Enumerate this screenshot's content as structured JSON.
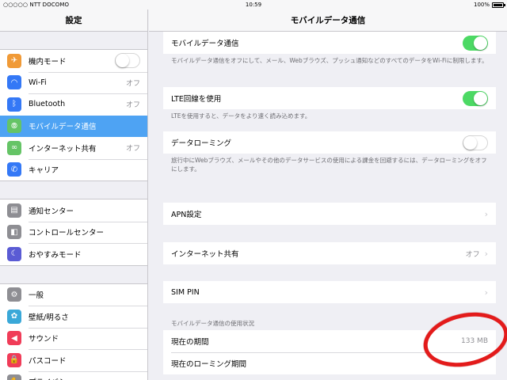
{
  "status_bar": {
    "carrier": "○○○○○ NTT DOCOMO",
    "time": "10:59",
    "battery": "100%"
  },
  "left": {
    "title": "設定",
    "groups": [
      [
        {
          "label": "機内モード",
          "icon": "airplane-icon",
          "color": "#f09a37",
          "glyph": "✈"
        },
        {
          "label": "Wi-Fi",
          "icon": "wifi-icon",
          "color": "#3478f6",
          "glyph": "◠",
          "value": "オフ"
        },
        {
          "label": "Bluetooth",
          "icon": "bluetooth-icon",
          "color": "#3478f6",
          "glyph": "ᛒ",
          "value": "オフ"
        },
        {
          "label": "モバイルデータ通信",
          "icon": "antenna-icon",
          "color": "#65c466",
          "glyph": "⦾",
          "selected": true
        },
        {
          "label": "インターネット共有",
          "icon": "hotspot-icon",
          "color": "#65c466",
          "glyph": "∞",
          "value": "オフ"
        },
        {
          "label": "キャリア",
          "icon": "phone-icon",
          "color": "#3478f6",
          "glyph": "✆"
        }
      ],
      [
        {
          "label": "通知センター",
          "icon": "notification-center-icon",
          "color": "#8e8e93",
          "glyph": "▤"
        },
        {
          "label": "コントロールセンター",
          "icon": "control-center-icon",
          "color": "#8e8e93",
          "glyph": "◧"
        },
        {
          "label": "おやすみモード",
          "icon": "moon-icon",
          "color": "#5a5bd4",
          "glyph": "☾"
        }
      ],
      [
        {
          "label": "一般",
          "icon": "gear-icon",
          "color": "#8e8e93",
          "glyph": "⚙"
        },
        {
          "label": "壁紙/明るさ",
          "icon": "wallpaper-icon",
          "color": "#3aa8d8",
          "glyph": "✿"
        },
        {
          "label": "サウンド",
          "icon": "sound-icon",
          "color": "#f03c58",
          "glyph": "◀"
        },
        {
          "label": "パスコード",
          "icon": "lock-icon",
          "color": "#f03c58",
          "glyph": "🔒"
        },
        {
          "label": "プライバシー",
          "icon": "hand-icon",
          "color": "#8e8e93",
          "glyph": "✋"
        }
      ]
    ]
  },
  "right": {
    "title": "モバイルデータ通信",
    "cellular_label": "モバイルデータ通信",
    "cellular_note": "モバイルデータ通信をオフにして、メール、Webブラウズ、プッシュ通知などのすべてのデータをWi-Fiに制限します。",
    "lte_label": "LTE回線を使用",
    "lte_note": "LTEを使用すると、データをより速く読み込めます。",
    "roaming_label": "データローミング",
    "roaming_note": "旅行中にWebブラウズ、メールやその他のデータサービスの使用による課金を回避するには、データローミングをオフにします。",
    "apn_label": "APN設定",
    "hotspot_label": "インターネット共有",
    "hotspot_value": "オフ",
    "sim_pin_label": "SIM PIN",
    "usage_section": "モバイルデータ通信の使用状況",
    "current_period_label": "現在の期間",
    "current_period_value": "133 MB",
    "roaming_period_label": "現在のローミング期間"
  },
  "colors": {
    "accent": "#4ea3f3",
    "toggle_on": "#4cd964",
    "annotation": "#e31b1b"
  }
}
